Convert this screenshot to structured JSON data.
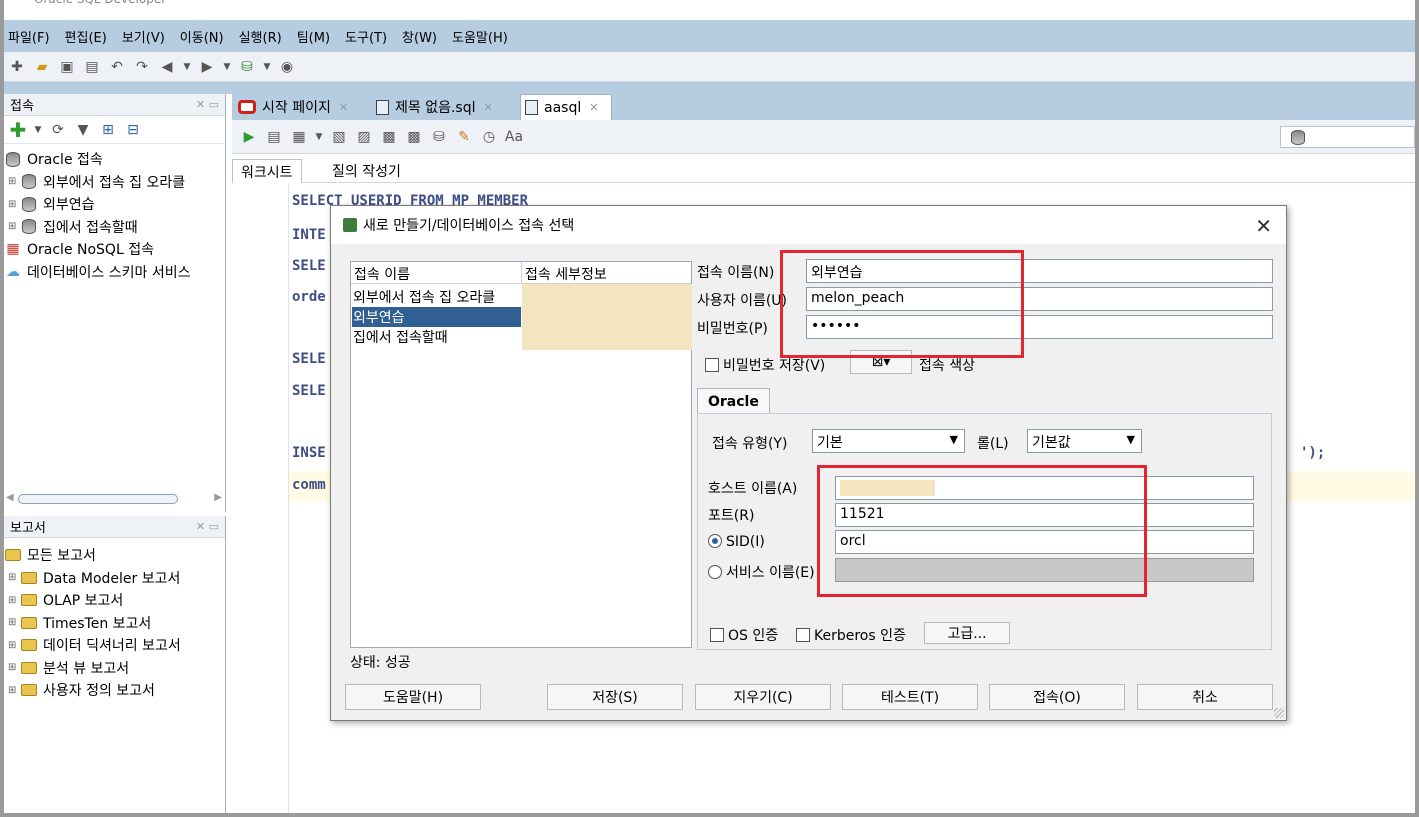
{
  "menu": [
    "파일(F)",
    "편집(E)",
    "보기(V)",
    "이동(N)",
    "실행(R)",
    "팀(M)",
    "도구(T)",
    "창(W)",
    "도움말(H)"
  ],
  "connections_panel": {
    "title": "접속",
    "tree": [
      {
        "label": "Oracle 접속",
        "icon": "database-icon",
        "expand": ""
      },
      {
        "label": "외부에서 접속 집 오라클",
        "icon": "database-icon",
        "expand": "⊞"
      },
      {
        "label": "외부연습",
        "icon": "database-icon",
        "expand": "⊞"
      },
      {
        "label": "집에서 접속할때",
        "icon": "database-icon",
        "expand": "⊞"
      },
      {
        "label": "Oracle NoSQL 접속",
        "icon": "nosql-icon",
        "expand": ""
      },
      {
        "label": "데이터베이스 스키마 서비스",
        "icon": "cloud-icon",
        "expand": ""
      }
    ]
  },
  "reports_panel": {
    "title": "보고서",
    "tree": [
      {
        "label": "모든 보고서",
        "expand": ""
      },
      {
        "label": "Data Modeler 보고서",
        "expand": "⊞"
      },
      {
        "label": "OLAP 보고서",
        "expand": "⊞"
      },
      {
        "label": "TimesTen 보고서",
        "expand": "⊞"
      },
      {
        "label": "데이터 딕셔너리 보고서",
        "expand": "⊞"
      },
      {
        "label": "분석 뷰 보고서",
        "expand": "⊞"
      },
      {
        "label": "사용자 정의 보고서",
        "expand": "⊞"
      }
    ]
  },
  "editor_tabs": [
    {
      "label": "시작 페이지"
    },
    {
      "label": "제목 없음.sql"
    },
    {
      "label": "aasql"
    }
  ],
  "sub_tabs": [
    "워크시트",
    "질의 작성기"
  ],
  "code_lines": [
    "SELECT USERID FROM MP_MEMBER",
    "INTE",
    "SELE",
    "orde",
    "SELE",
    "SELE",
    "INSE",
    "comm"
  ],
  "code_tail": "');",
  "dialog": {
    "title": "새로 만들기/데이터베이스 접속 선택",
    "list_headers": [
      "접속 이름",
      "접속 세부정보"
    ],
    "list_items": [
      "외부에서 접속 집 오라클",
      "외부연습",
      "집에서 접속할때"
    ],
    "selected_index": 1,
    "labels": {
      "conn_name": "접속 이름(N)",
      "user": "사용자 이름(U)",
      "password": "비밀번호(P)",
      "save_password": "비밀번호 저장(V)",
      "conn_color": "접속 색상",
      "oracle_tab": "Oracle",
      "conn_type": "접속 유형(Y)",
      "role": "롤(L)",
      "host": "호스트 이름(A)",
      "port": "포트(R)",
      "sid": "SID(I)",
      "service": "서비스 이름(E)",
      "os_auth": "OS 인증",
      "kerberos": "Kerberos 인증",
      "advanced": "고급..."
    },
    "values": {
      "conn_name": "외부연습",
      "user": "melon_peach",
      "password": "••••••",
      "conn_type": "기본",
      "role": "기본값",
      "port": "11521",
      "sid": "orcl"
    },
    "status": "상태: 성공",
    "buttons": [
      "도움말(H)",
      "저장(S)",
      "지우기(C)",
      "테스트(T)",
      "접속(O)",
      "취소"
    ]
  },
  "colors": {
    "menubar": "#b6cce0",
    "highlight": "#e32530",
    "selection": "#2f5f93"
  }
}
